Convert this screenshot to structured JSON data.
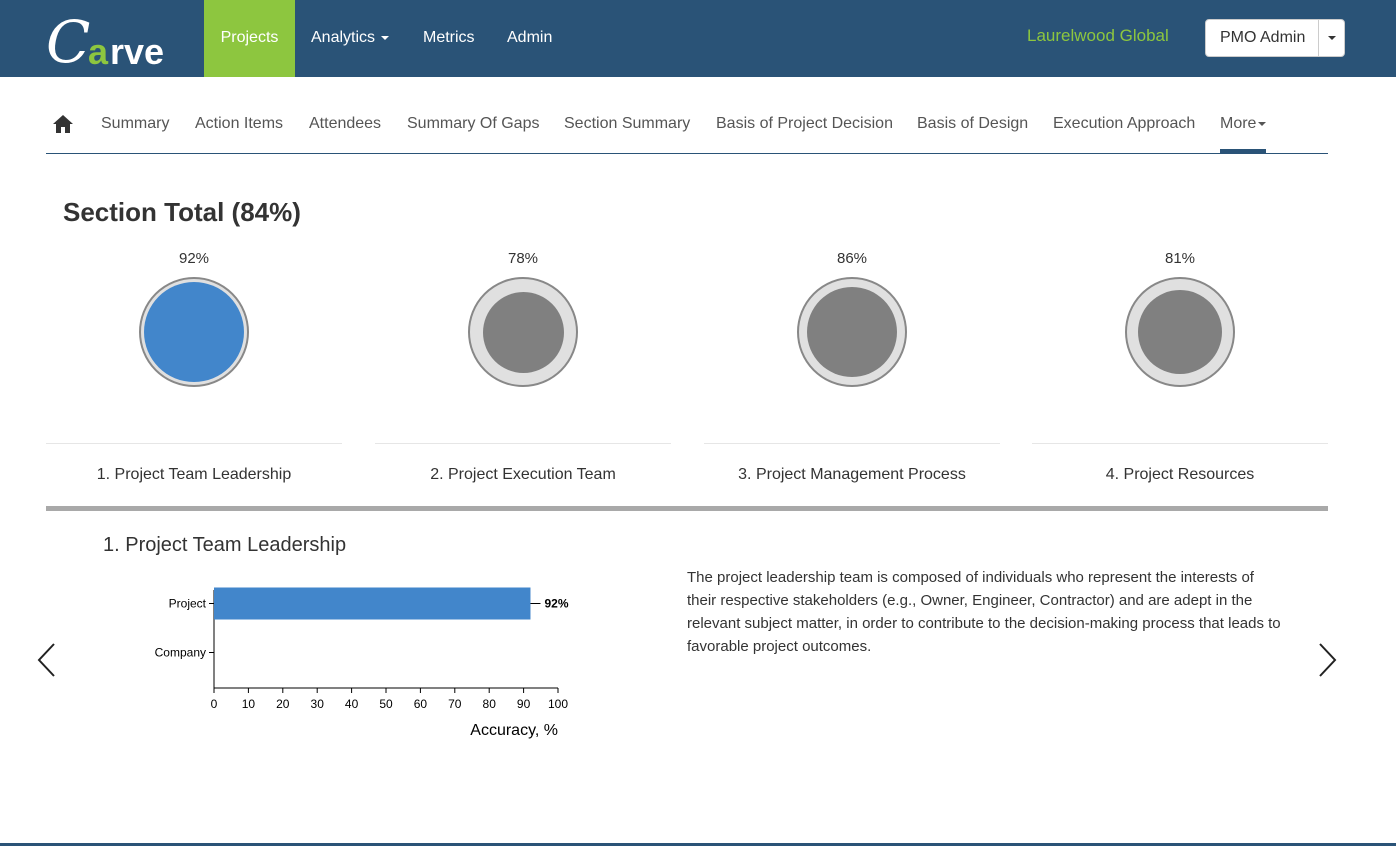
{
  "app": {
    "logo_text": "Carve"
  },
  "navbar": {
    "items": [
      {
        "label": "Projects",
        "active": true
      },
      {
        "label": "Analytics",
        "dropdown": true
      },
      {
        "label": "Metrics"
      },
      {
        "label": "Admin"
      }
    ],
    "org_name": "Laurelwood Global",
    "user_label": "PMO Admin"
  },
  "subtabs": {
    "home_icon": "home-icon",
    "items": [
      "Summary",
      "Action Items",
      "Attendees",
      "Summary Of Gaps",
      "Section Summary",
      "Basis of Project Decision",
      "Basis of Design",
      "Execution Approach",
      "More"
    ]
  },
  "section_total": {
    "title": "Section Total (84%)"
  },
  "sections": [
    {
      "pct": "92%",
      "value": 92,
      "label": "1. Project Team Leadership",
      "selected": true,
      "color": "#4286cb"
    },
    {
      "pct": "78%",
      "value": 78,
      "label": "2. Project Execution Team",
      "selected": false,
      "color": "#808080"
    },
    {
      "pct": "86%",
      "value": 86,
      "label": "3. Project Management Process",
      "selected": false,
      "color": "#808080"
    },
    {
      "pct": "81%",
      "value": 81,
      "label": "4. Project Resources",
      "selected": false,
      "color": "#808080"
    }
  ],
  "detail": {
    "title": "1. Project Team Leadership",
    "description": "The project leadership team is composed of individuals who represent the interests of their respective stakeholders (e.g., Owner, Engineer, Contractor) and are adept in the relevant subject matter, in order to contribute to the decision-making process that leads to favorable project outcomes."
  },
  "chart_data": {
    "type": "bar",
    "orientation": "horizontal",
    "categories": [
      "Project",
      "Company"
    ],
    "values": [
      92,
      null
    ],
    "value_labels": [
      "92%",
      ""
    ],
    "xlabel": "Accuracy, %",
    "ylabel": "",
    "xlim": [
      0,
      100
    ],
    "xticks": [
      0,
      10,
      20,
      30,
      40,
      50,
      60,
      70,
      80,
      90,
      100
    ],
    "bar_color": "#4286cb",
    "grid": false
  },
  "colors": {
    "navbar": "#2a5377",
    "accent_green": "#8dc63f",
    "bar_blue": "#4286cb"
  }
}
